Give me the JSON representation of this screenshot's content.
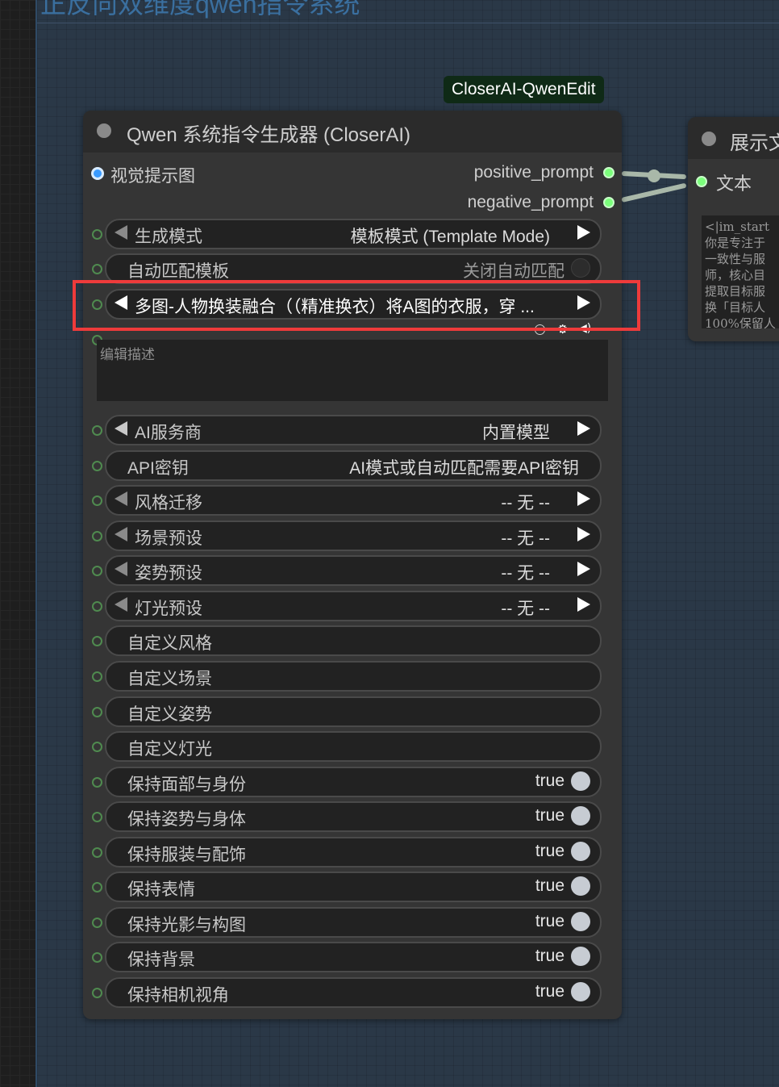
{
  "group": {
    "title": "正反向双维度qwen指令系统"
  },
  "badge": {
    "label": "CloserAI-QwenEdit"
  },
  "node": {
    "title": "Qwen 系统指令生成器 (CloserAI)",
    "inputs": [
      {
        "label": "视觉提示图"
      }
    ],
    "outputs": [
      {
        "label": "positive_prompt"
      },
      {
        "label": "negative_prompt"
      }
    ],
    "widgets": [
      {
        "label": "生成模式",
        "value": "模板模式 (Template Mode)",
        "type": "combo"
      },
      {
        "label": "自动匹配模板",
        "value": "关闭自动匹配",
        "type": "toggle-off"
      },
      {
        "label": "多图-人物换装融合（（精准换衣）将A图的衣服，穿 ...",
        "value": "",
        "type": "combo-selected"
      },
      {
        "label": "AI服务商",
        "value": "内置模型",
        "type": "combo"
      },
      {
        "label": "API密钥",
        "value": "AI模式或自动匹配需要API密钥",
        "type": "text"
      },
      {
        "label": "风格迁移",
        "value": "-- 无 --",
        "type": "combo-dim"
      },
      {
        "label": "场景预设",
        "value": "-- 无 --",
        "type": "combo-dim"
      },
      {
        "label": "姿势预设",
        "value": "-- 无 --",
        "type": "combo-dim"
      },
      {
        "label": "灯光预设",
        "value": "-- 无 --",
        "type": "combo-dim"
      },
      {
        "label": "自定义风格",
        "value": "",
        "type": "text"
      },
      {
        "label": "自定义场景",
        "value": "",
        "type": "text"
      },
      {
        "label": "自定义姿势",
        "value": "",
        "type": "text"
      },
      {
        "label": "自定义灯光",
        "value": "",
        "type": "text"
      },
      {
        "label": "保持面部与身份",
        "value": "true",
        "type": "toggle"
      },
      {
        "label": "保持姿势与身体",
        "value": "true",
        "type": "toggle"
      },
      {
        "label": "保持服装与配饰",
        "value": "true",
        "type": "toggle"
      },
      {
        "label": "保持表情",
        "value": "true",
        "type": "toggle"
      },
      {
        "label": "保持光影与构图",
        "value": "true",
        "type": "toggle"
      },
      {
        "label": "保持背景",
        "value": "true",
        "type": "toggle"
      },
      {
        "label": "保持相机视角",
        "value": "true",
        "type": "toggle"
      }
    ],
    "description_placeholder": "编辑描述"
  },
  "display_node": {
    "title": "展示文",
    "input_label": "文本",
    "text": "<|im_start\n你是专注于\n一致性与服\n师，核心目\n提取目标服\n换「目标人\n100%保留人"
  },
  "colors": {
    "accent_highlight": "#ee3b3b",
    "output_slot": "#7bff7b",
    "image_slot": "#3a9bff",
    "badge_bg": "#0f2a16"
  }
}
